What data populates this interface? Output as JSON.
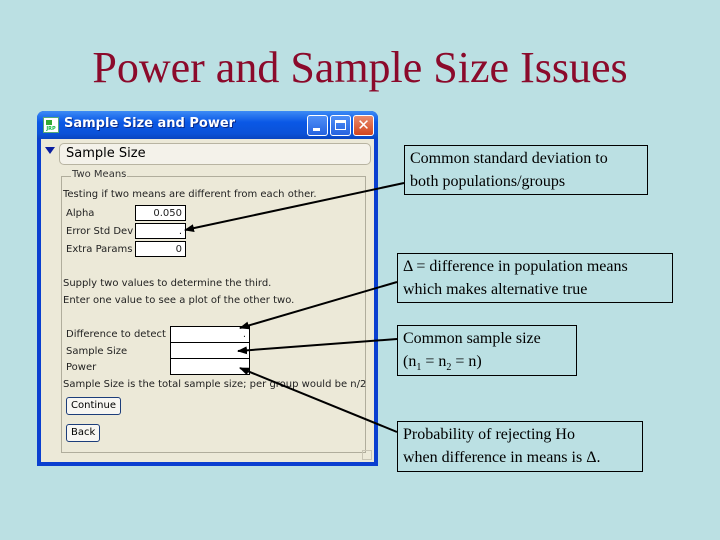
{
  "slide": {
    "title": "Power and Sample Size Issues"
  },
  "window": {
    "title": "Sample Size and Power",
    "app_icon": "jmp-app-icon",
    "controls": {
      "minimize": "_",
      "maximize": "□",
      "close": "✕"
    }
  },
  "panel": {
    "header": "Sample Size",
    "group_label": "Two Means",
    "description": "Testing if two means are different from each other.",
    "params": [
      {
        "label": "Alpha",
        "value": "0.050"
      },
      {
        "label": "Error Std Dev",
        "value": "."
      },
      {
        "label": "Extra Params",
        "value": "0"
      }
    ],
    "instructions": [
      "Supply two values to determine the third.",
      "Enter one value to see a plot of the other two."
    ],
    "solve_fields": [
      {
        "label": "Difference to detect",
        "value": "."
      },
      {
        "label": "Sample Size",
        "value": "."
      },
      {
        "label": "Power",
        "value": ""
      }
    ],
    "note": "Sample Size is the total sample size; per group would be n/2",
    "continue_label": "Continue",
    "back_label": "Back"
  },
  "callouts": {
    "std_dev": {
      "line1": "Common standard deviation to",
      "line2": "both populations/groups"
    },
    "difference": {
      "line1": "Δ = difference in population means",
      "line2": "which makes alternative true"
    },
    "sample_size": {
      "line1": "Common sample size",
      "line2_pre": "(n",
      "sub1": "1",
      "mid": " = n",
      "sub2": "2",
      "post": " = n)"
    },
    "power": {
      "line1": "Probability of rejecting Ho",
      "line2": "when difference in means is Δ."
    }
  },
  "colors": {
    "background": "#bbe0e3",
    "title": "#8b0a2b",
    "window_frame": "#0a3fd0",
    "client": "#ece9d8"
  }
}
